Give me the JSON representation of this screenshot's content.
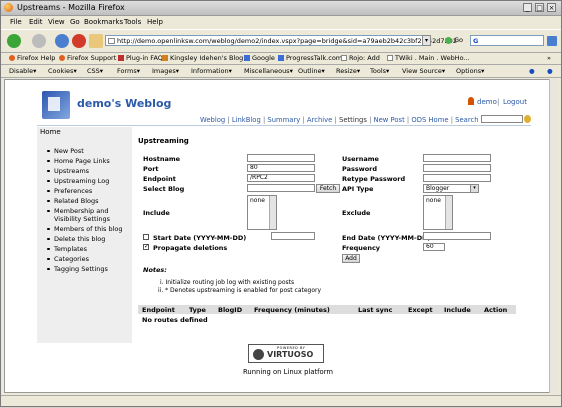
{
  "window": {
    "title": "Upstreams - Mozilla Firefox"
  },
  "menu": [
    "File",
    "Edit",
    "View",
    "Go",
    "Bookmarks",
    "Tools",
    "Help"
  ],
  "nav": {
    "url": "http://demo.openlinksw.com/weblog/demo2/index.vspx?page=bridge&sid=a79aeb2b42c3bf25f42d7202",
    "go_label": "Go",
    "search_label": "G"
  },
  "bookmarks": [
    "Firefox Help",
    "Firefox Support",
    "Plug-in FAQ",
    "Kingsley Idehen's Blog",
    "Google",
    "ProgressTalk.com",
    "Rojo: Add",
    "TWiki . Main . WebHo..."
  ],
  "devbar": [
    "Disable▾",
    "Cookies▾",
    "CSS▾",
    "Forms▾",
    "Images▾",
    "Information▾",
    "Miscellaneous▾",
    "Outline▾",
    "Resize▾",
    "Tools▾",
    "View Source▾",
    "Options▾"
  ],
  "blog": {
    "title": "demo's Weblog",
    "user": "demo",
    "logout": "Logout",
    "header_sep": "|",
    "links": [
      "Weblog",
      "LinkBlog",
      "Summary",
      "Archive",
      "Settings",
      "New Post",
      "ODS Home",
      "Search"
    ],
    "sep": "|"
  },
  "sidebar": {
    "home": "Home",
    "items": [
      "New Post",
      "Home Page Links",
      "Upstreams",
      "Upstreaming Log",
      "Preferences",
      "Related Blogs",
      "Membership and",
      "Visibility Settings",
      "Members of this blog",
      "Delete this blog",
      "Templates",
      "Categories",
      "Tagging Settings"
    ]
  },
  "form": {
    "heading": "Upstreaming",
    "hostname": "Hostname",
    "hostname_value": "",
    "port": "Port",
    "port_value": "80",
    "endpoint": "Endpoint",
    "endpoint_value": "/RPC2",
    "select_blog": "Select Blog",
    "fetch": "Fetch",
    "include": "Include",
    "include_opt": "none",
    "start_date": "Start Date (YYYY-MM-DD)",
    "start_date_value": "",
    "propagate": "Propagate deletions",
    "username": "Username",
    "password": "Password",
    "retype": "Retype Password",
    "api_type": "API Type",
    "api_value": "Blogger",
    "exclude": "Exclude",
    "exclude_opt": "none",
    "end_date": "End Date (YYYY-MM-DD)",
    "frequency": "Frequency",
    "frequency_value": "60",
    "add": "Add"
  },
  "notes": {
    "title": "Notes:",
    "i": "i.   Initialize routing job log with existing posts",
    "ii": "ii.   * Denotes upstreaming is enabled for post category"
  },
  "table": {
    "headers": [
      "Endpoint",
      "Type",
      "BlogID",
      "Frequency (minutes)",
      "Last sync",
      "Except",
      "Include",
      "Action"
    ],
    "empty": "No routes defined"
  },
  "footer": {
    "powered": "POWERED BY",
    "brand": "VIRTUOSO",
    "platform": "Running on Linux platform"
  }
}
